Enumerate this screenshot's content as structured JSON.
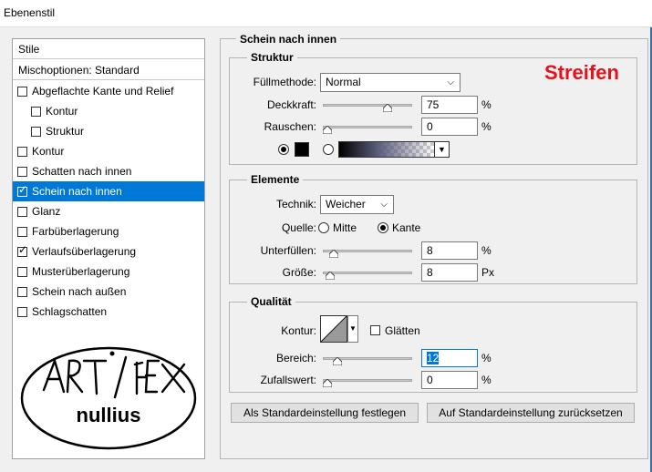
{
  "window": {
    "title": "Ebenenstil"
  },
  "left_panel": {
    "header": "Stile",
    "blend_options": "Mischoptionen: Standard",
    "items": [
      {
        "label": "Abgeflachte Kante und Relief",
        "checked": false,
        "indent": 0,
        "selected": false
      },
      {
        "label": "Kontur",
        "checked": false,
        "indent": 1,
        "selected": false
      },
      {
        "label": "Struktur",
        "checked": false,
        "indent": 1,
        "selected": false
      },
      {
        "label": "Kontur",
        "checked": false,
        "indent": 0,
        "selected": false
      },
      {
        "label": "Schatten nach innen",
        "checked": false,
        "indent": 0,
        "selected": false
      },
      {
        "label": "Schein nach innen",
        "checked": true,
        "indent": 0,
        "selected": true
      },
      {
        "label": "Glanz",
        "checked": false,
        "indent": 0,
        "selected": false
      },
      {
        "label": "Farbüberlagerung",
        "checked": false,
        "indent": 0,
        "selected": false
      },
      {
        "label": "Verlaufsüberlagerung",
        "checked": true,
        "indent": 0,
        "selected": false
      },
      {
        "label": "Musterüberlagerung",
        "checked": false,
        "indent": 0,
        "selected": false
      },
      {
        "label": "Schein nach außen",
        "checked": false,
        "indent": 0,
        "selected": false
      },
      {
        "label": "Schlagschatten",
        "checked": false,
        "indent": 0,
        "selected": false
      }
    ],
    "logo": {
      "line1": "ART / FEX",
      "line2": "nullius"
    }
  },
  "main": {
    "section_title": "Schein nach innen",
    "annotation": "Streifen",
    "struktur": {
      "title": "Struktur",
      "fill_method_label": "Füllmethode:",
      "fill_method_value": "Normal",
      "opacity_label": "Deckkraft:",
      "opacity_value": "75",
      "opacity_unit": "%",
      "opacity_level": 0.75,
      "noise_label": "Rauschen:",
      "noise_value": "0",
      "noise_unit": "%",
      "noise_level": 0.0,
      "color_mode": "solid"
    },
    "elemente": {
      "title": "Elemente",
      "technique_label": "Technik:",
      "technique_value": "Weicher",
      "source_label": "Quelle:",
      "source_options": [
        "Mitte",
        "Kante"
      ],
      "source_selected": "Kante",
      "choke_label": "Unterfüllen:",
      "choke_value": "8",
      "choke_unit": "%",
      "choke_level": 0.08,
      "size_label": "Größe:",
      "size_value": "8",
      "size_unit": "Px",
      "size_level": 0.03
    },
    "qualitaet": {
      "title": "Qualität",
      "contour_label": "Kontur:",
      "antialias_label": "Glätten",
      "antialias_checked": false,
      "range_label": "Bereich:",
      "range_value": "12",
      "range_unit": "%",
      "range_level": 0.12,
      "jitter_label": "Zufallswert:",
      "jitter_value": "0",
      "jitter_unit": "%",
      "jitter_level": 0.0
    },
    "buttons": {
      "set_default": "Als Standardeinstellung festlegen",
      "reset_default": "Auf Standardeinstellung zurücksetzen"
    }
  },
  "colors": {
    "selection": "#0078d7",
    "annotation": "#e8101a"
  }
}
